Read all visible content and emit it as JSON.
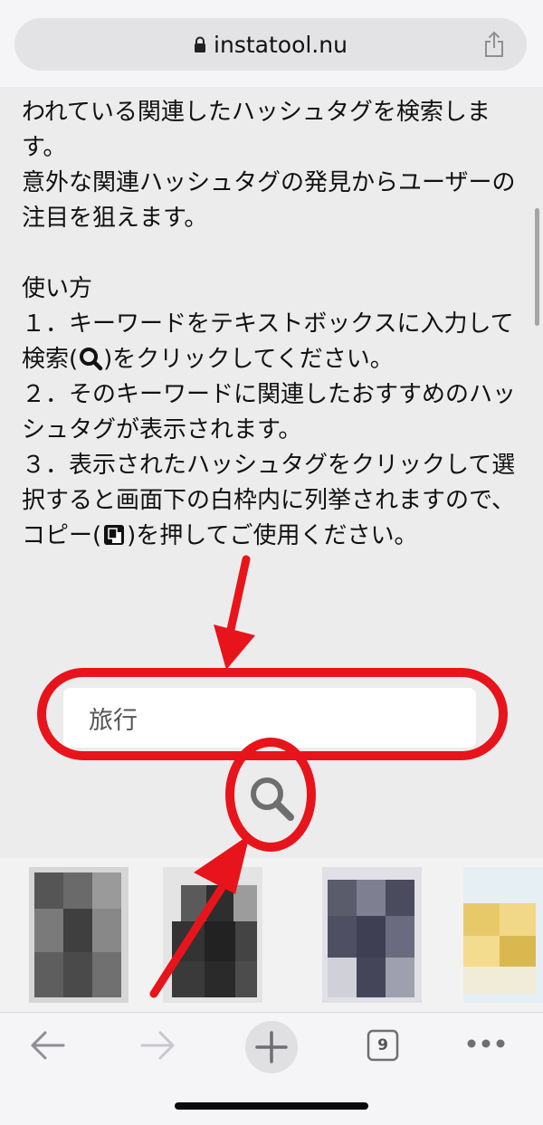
{
  "browser": {
    "url": "instatool.nu",
    "tab_count": "9"
  },
  "content": {
    "line1": "われている関連したハッシュタグを検索します。",
    "line2": "意外な関連ハッシュタグの発見からユーザーの注目を狙えます。",
    "howto_title": "使い方",
    "step1_a": "１．キーワードをテキストボックスに入力して検索(",
    "step1_b": ")をクリックしてください。",
    "step2": "２．そのキーワードに関連したおすすめのハッシュタグが表示されます。",
    "step3": "３．表示されたハッシュタグをクリックして選択すると画面下の白枠内に列挙されますので、",
    "step3_copy_a": "コピー(",
    "step3_copy_b": ")を押してご使用ください。"
  },
  "search": {
    "value": "旅行"
  },
  "icons": {
    "lock": "lock-icon",
    "share": "share-icon",
    "search": "search-icon",
    "copy": "copy-icon",
    "back": "back-arrow-icon",
    "forward": "forward-arrow-icon",
    "new_tab": "plus-icon",
    "tabs": "tabs-icon",
    "more": "more-icon"
  },
  "colors": {
    "annotation_red": "#e8141b",
    "page_bg": "#ececed"
  }
}
